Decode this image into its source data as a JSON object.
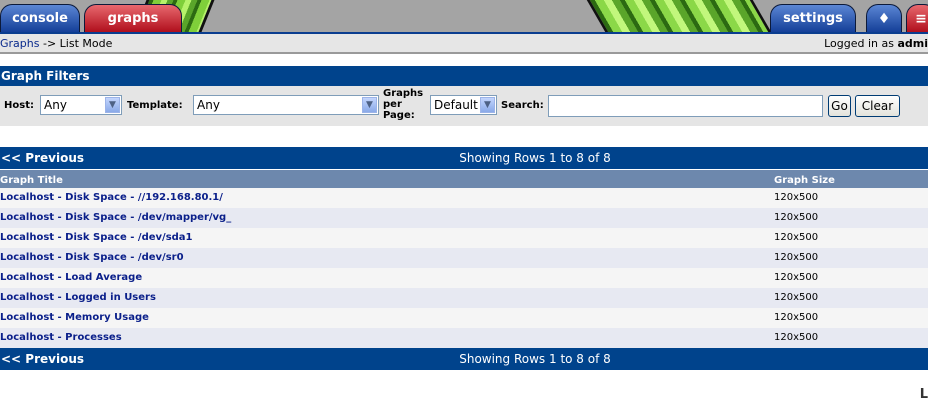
{
  "tabs": {
    "console": "console",
    "graphs": "graphs",
    "settings": "settings"
  },
  "breadcrumb": {
    "link": "Graphs",
    "sep": " -> ",
    "current": "List Mode"
  },
  "login": {
    "prefix": "Logged in as ",
    "user": "admi"
  },
  "filters": {
    "title": "Graph Filters",
    "host_label": "Host:",
    "host_value": "Any",
    "template_label": "Template:",
    "template_value": "Any",
    "gpp_label_1": "Graphs",
    "gpp_label_2": "per",
    "gpp_label_3": "Page:",
    "gpp_value": "Default",
    "search_label": "Search:",
    "search_value": "",
    "go": "Go",
    "clear": "Clear"
  },
  "pager": {
    "previous": "<< Previous",
    "showing": "Showing Rows 1 to 8 of 8"
  },
  "table": {
    "headers": {
      "title": "Graph Title",
      "size": "Graph Size"
    },
    "rows": [
      {
        "title": "Localhost - Disk Space - //192.168.80.1/",
        "size": "120x500"
      },
      {
        "title": "Localhost - Disk Space - /dev/mapper/vg_",
        "size": "120x500"
      },
      {
        "title": "Localhost - Disk Space - /dev/sda1",
        "size": "120x500"
      },
      {
        "title": "Localhost - Disk Space - /dev/sr0",
        "size": "120x500"
      },
      {
        "title": "Localhost - Load Average",
        "size": "120x500"
      },
      {
        "title": "Localhost - Logged in Users",
        "size": "120x500"
      },
      {
        "title": "Localhost - Memory Usage",
        "size": "120x500"
      },
      {
        "title": "Localhost - Processes",
        "size": "120x500"
      }
    ]
  },
  "footer_glyph": "L"
}
